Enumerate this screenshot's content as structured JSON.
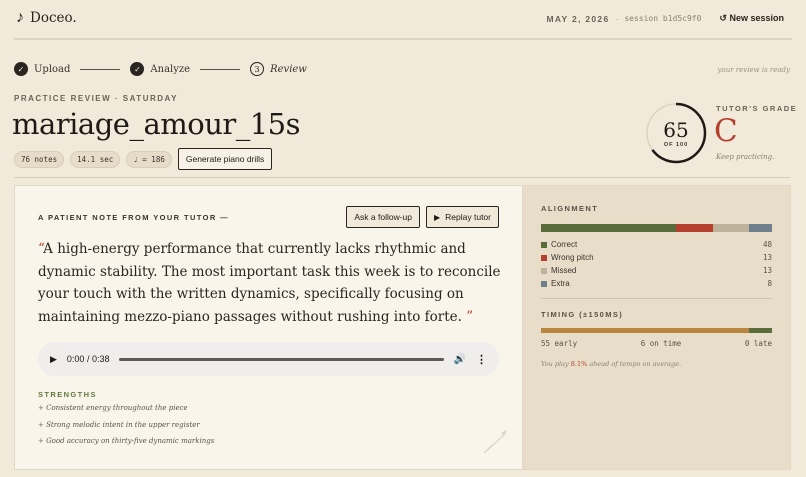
{
  "header": {
    "app_name": "Doceo.",
    "logo_icon": "music-note-icon",
    "date": "MAY 2, 2026",
    "separator": "·",
    "session": "session b1d5c9f0",
    "new_session_icon": "↺",
    "new_session_label": "New session"
  },
  "steps": [
    {
      "label": "Upload",
      "state": "done",
      "mark": "✓"
    },
    {
      "label": "Analyze",
      "state": "done",
      "mark": "✓"
    },
    {
      "label": "Review",
      "state": "current",
      "mark": "3"
    }
  ],
  "ready_note": "your review is ready",
  "review": {
    "eyebrow": "PRACTICE REVIEW · SATURDAY",
    "title": "mariage_amour_15s",
    "chips": [
      "76 notes",
      "14.1 sec",
      "♩ = 186"
    ],
    "drills_button": "Generate piano drills"
  },
  "grade": {
    "score": "65",
    "score_value": 65,
    "score_max": 100,
    "of_label": "OF 100",
    "label": "TUTOR'S GRADE",
    "letter": "C",
    "note": "Keep practicing."
  },
  "note": {
    "eyebrow": "A PATIENT NOTE FROM YOUR TUTOR —",
    "ask_button": "Ask a follow-up",
    "replay_button": "Replay tutor",
    "open_quote": "“",
    "close_quote": "”",
    "text": "A high-energy performance that currently lacks rhythmic and dynamic stability. The most important task this week is to reconcile your touch with the written dynamics, specifically focusing on maintaining mezzo-piano passages without rushing into forte."
  },
  "audio": {
    "time": "0:00 / 0:38",
    "progress": 0
  },
  "strengths": {
    "label": "STRENGTHS",
    "items": [
      "Consistent energy throughout the piece",
      "Strong melodic intent in the upper register",
      "Good accuracy on thirty-five dynamic markings"
    ]
  },
  "alignment": {
    "label": "ALIGNMENT",
    "items": [
      {
        "name": "Correct",
        "value": 48,
        "color": "#5a6b3c"
      },
      {
        "name": "Wrong pitch",
        "value": 13,
        "color": "#b5402e"
      },
      {
        "name": "Missed",
        "value": 13,
        "color": "#bfb29a"
      },
      {
        "name": "Extra",
        "value": 8,
        "color": "#6f7f8c"
      }
    ]
  },
  "timing": {
    "label": "TIMING (±150MS)",
    "items": [
      {
        "name": "early",
        "value": 55,
        "color": "#b8863f"
      },
      {
        "name": "on time",
        "value": 6,
        "color": "#5a6b3c"
      },
      {
        "name": "late",
        "value": 0,
        "color": "#b5402e"
      }
    ],
    "labels": [
      "55 early",
      "6 on time",
      "0 late"
    ],
    "note_prefix": "You play ",
    "note_value": "8.1%",
    "note_suffix": " ahead of tempo on average."
  }
}
